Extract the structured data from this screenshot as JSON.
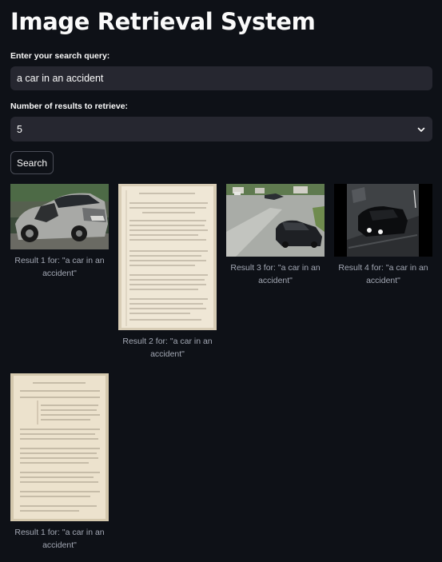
{
  "app": {
    "title": "Image Retrieval System"
  },
  "query": {
    "label": "Enter your search query:",
    "value": "a car in an accident"
  },
  "num_results": {
    "label": "Number of results to retrieve:",
    "value": "5"
  },
  "search_button": {
    "label": "Search"
  },
  "results": [
    {
      "caption": "Result 1 for: \"a car in an accident\"",
      "image": "wrecked-car-photo"
    },
    {
      "caption": "Result 2 for: \"a car in an accident\"",
      "image": "handwritten-manuscript-page"
    },
    {
      "caption": "Result 3 for: \"a car in an accident\"",
      "image": "street-intersection-cctv"
    },
    {
      "caption": "Result 4 for: \"a car in an accident\"",
      "image": "night-security-camera-car"
    },
    {
      "caption": "Result 1 for: \"a car in an accident\"",
      "image": "handwritten-manuscript-page"
    }
  ],
  "colors": {
    "background": "#0e1117",
    "input_bg": "#262730",
    "caption": "#a3a8b4",
    "text": "#fafafa"
  }
}
